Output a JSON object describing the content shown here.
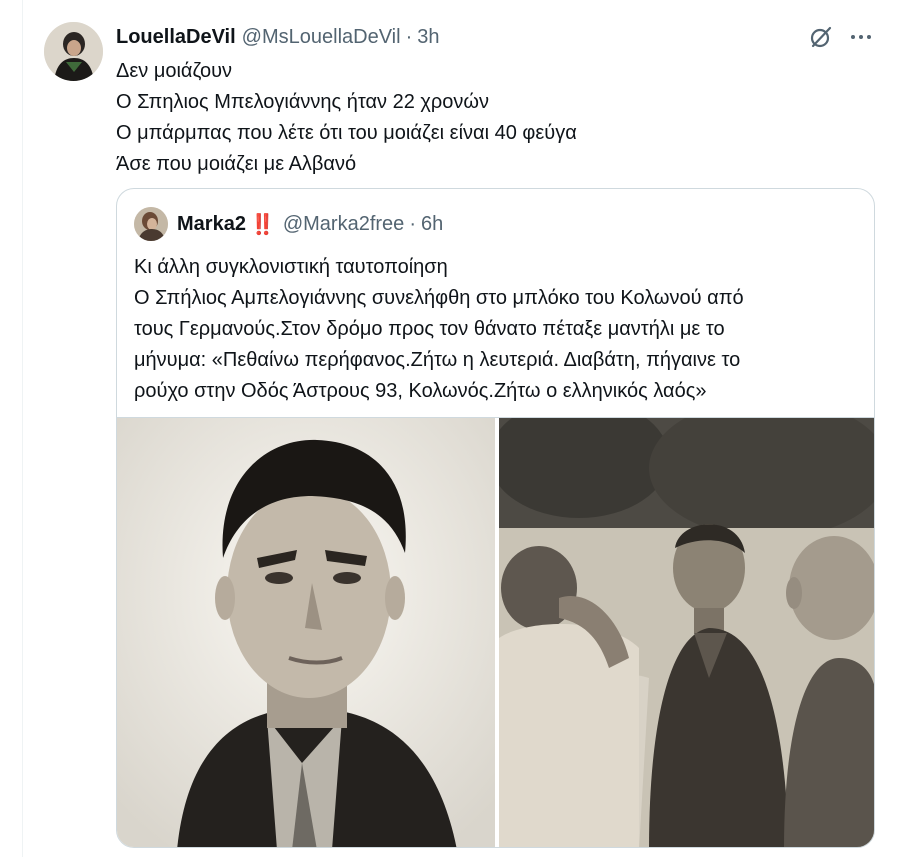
{
  "tweet": {
    "display_name": "LouellaDeVil",
    "handle": "@MsLouellaDeVil",
    "separator": "·",
    "time": "3h",
    "lines": [
      "Δεν μοιάζουν",
      "Ο Σπηλιος Μπελογιάννης ήταν 22 χρονών",
      "Ο μπάρμπας που λέτε ότι του μοιάζει είναι 40 φεύγα",
      "Άσε που μοιάζει με Αλβανό"
    ]
  },
  "quote": {
    "display_name": "Marka2",
    "badge": "‼️",
    "handle": "@Marka2free",
    "separator": "·",
    "time": "6h",
    "lines": [
      "Κι άλλη συγκλονιστική ταυτοποίηση",
      "Ο Σπήλιος Αμπελογιάννης συνελήφθη στο μπλόκο του Κολωνού από",
      "τους Γερμανούς.Στον δρόμο προς τον θάνατο πέταξε μαντήλι με το",
      "μήνυμα: «Πεθαίνω περήφανος.Ζήτω η λευτεριά. Διαβάτη, πήγαινε το",
      "ρούχο στην Οδός Άστρους 93, Κολωνός.Ζήτω ο ελληνικός λαός»"
    ]
  },
  "icons": {
    "grok": "grok-icon",
    "more": "more-icon"
  },
  "colors": {
    "text": "#0f1419",
    "secondary": "#536471",
    "border": "#cfd9de",
    "badge": "#d7262e"
  }
}
